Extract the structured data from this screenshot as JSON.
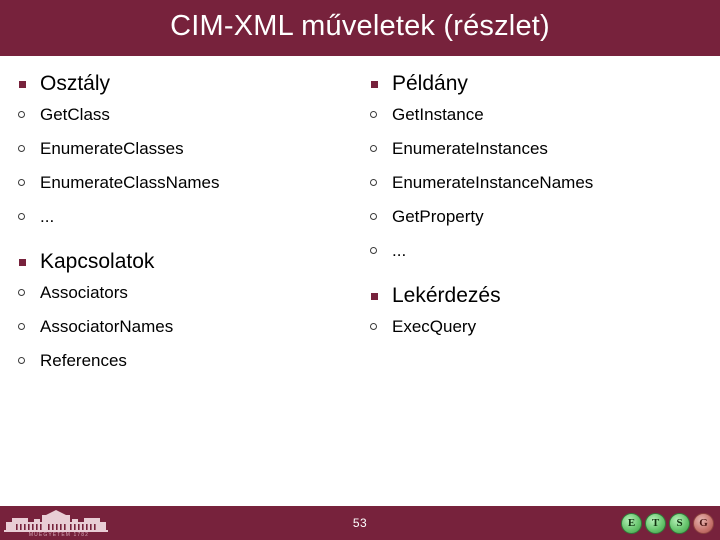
{
  "slide": {
    "title": "CIM-XML műveletek (részlet)",
    "page_number": "53",
    "accent_color": "#77223c",
    "background_color": "#ffffff",
    "title_color": "#ffffff"
  },
  "left_column": {
    "sections": [
      {
        "heading": "Osztály",
        "items": [
          "GetClass",
          "EnumerateClasses",
          "EnumerateClassNames",
          "..."
        ]
      },
      {
        "heading": "Kapcsolatok",
        "items": [
          "Associators",
          "AssociatorNames",
          "References"
        ]
      }
    ]
  },
  "right_column": {
    "sections": [
      {
        "heading": "Példány",
        "items": [
          "GetInstance",
          "EnumerateInstances",
          "EnumerateInstanceNames",
          "GetProperty",
          "..."
        ]
      },
      {
        "heading": "Lekérdezés",
        "items": [
          "ExecQuery"
        ]
      }
    ]
  },
  "footer": {
    "logo_caption": "MŰEGYETEM 1782",
    "badges": [
      {
        "label": "E",
        "style": "green"
      },
      {
        "label": "T",
        "style": "green"
      },
      {
        "label": "S",
        "style": "green"
      },
      {
        "label": "G",
        "style": "faded"
      }
    ]
  }
}
